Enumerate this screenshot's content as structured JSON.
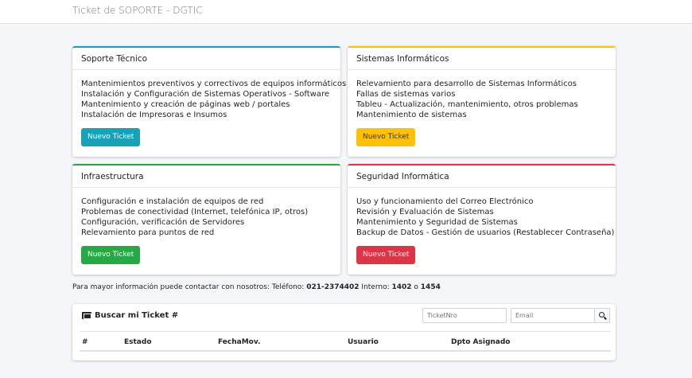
{
  "header": {
    "title": "Ticket de SOPORTE - DGTIC"
  },
  "cards": [
    {
      "title": "Soporte Técnico",
      "items": [
        "Mantenimientos preventivos y correctivos de equipos informáticos",
        "Instalación y Configuración de Sistemas Operativos - Software",
        "Mantenimiento y creación de páginas web / portales",
        "Instalación de Impresoras e Insumos"
      ],
      "button": "Nuevo Ticket",
      "color": "#17a2b8"
    },
    {
      "title": "Sistemas Informáticos",
      "items": [
        "Relevamiento para desarrollo de Sistemas Informáticos",
        "Fallas de sistemas varios",
        "Tableu - Actualización, mantenimiento, otros problemas",
        "Mantenimiento de sistemas"
      ],
      "button": "Nuevo Ticket",
      "color": "#ffc107"
    },
    {
      "title": "Infraestructura",
      "items": [
        "Configuración e instalación de equipos de red",
        "Problemas de conectividad (Internet, telefónica IP, otros)",
        "Configuración, verificación de Servidores",
        "Relevamiento para puntos de red"
      ],
      "button": "Nuevo Ticket",
      "color": "#28a745"
    },
    {
      "title": "Seguridad Informática",
      "items": [
        "Uso y funcionamiento del Correo Electrónico",
        "Revisión y Evaluación de Sistemas",
        "Mantenimiento y Seguridad de Sistemas",
        "Backup de Datos - Gestión de usuarios (Restablecer Contraseña)"
      ],
      "button": "Nuevo Ticket",
      "color": "#dc3545"
    }
  ],
  "contact": {
    "prefix": "Para mayor información puede contactar con nosotros: Teléfono: ",
    "phone": "021-2374402",
    "internal_label": " Interno: ",
    "ext1": "1402",
    "or": " o ",
    "ext2": "1454"
  },
  "search": {
    "title": "Buscar mi Ticket #",
    "ticket_placeholder": "TicketNro",
    "email_placeholder": "Email",
    "columns": [
      "#",
      "Estado",
      "FechaMov.",
      "Usuario",
      "Dpto Asignado"
    ]
  }
}
